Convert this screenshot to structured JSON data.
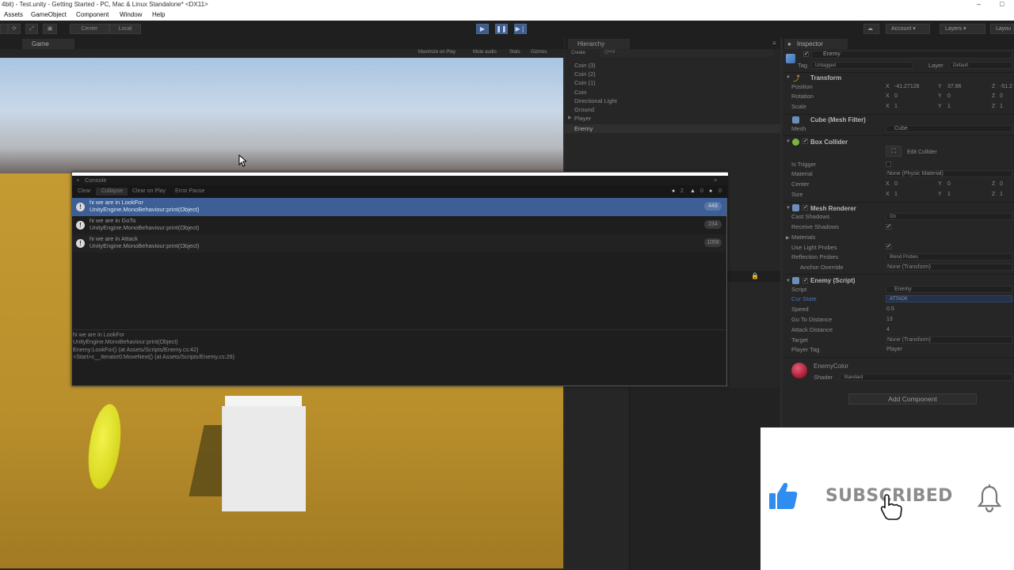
{
  "window": {
    "title": "4bit) - Test.unity - Getting Started - PC, Mac & Linux Standalone* <DX11>",
    "minimize": "–",
    "maximize": "□"
  },
  "menu": [
    "Assets",
    "GameObject",
    "Component",
    "Window",
    "Help"
  ],
  "toolbar": {
    "pivot": "Center",
    "space": "Local",
    "account": "Account",
    "layers": "Layers",
    "layout": "Layou"
  },
  "game": {
    "tab_label": "Game",
    "options": [
      "Maximize on Play",
      "Mute audio",
      "Stats",
      "Gizmos"
    ]
  },
  "hierarchy": {
    "tab_label": "Hierarchy",
    "create": "Create",
    "search_placeholder": "Q•All",
    "items": [
      "Coin (3)",
      "Coin (2)",
      "Coin (1)",
      "Coin",
      "Directional Light",
      "Ground",
      "Player",
      "Enemy"
    ]
  },
  "inspector": {
    "tab_label": "Inspector",
    "object_name": "Enemy",
    "tag_label": "Tag",
    "tag_value": "Untagged",
    "layer_label": "Layer",
    "layer_value": "Default",
    "transform": {
      "title": "Transform",
      "position_label": "Position",
      "rotation_label": "Rotation",
      "scale_label": "Scale",
      "position": [
        "-41.27128",
        "37.86",
        "-51.2"
      ],
      "rotation": [
        "0",
        "0",
        "0"
      ],
      "scale": [
        "1",
        "1",
        "1"
      ]
    },
    "mesh_filter": {
      "title": "Cube (Mesh Filter)",
      "mesh_label": "Mesh",
      "mesh_value": "Cube"
    },
    "box_collider": {
      "title": "Box Collider",
      "edit_button": "Edit Collider",
      "is_trigger_label": "Is Trigger",
      "material_label": "Material",
      "material_value": "None (Physic Material)",
      "center_label": "Center",
      "center": [
        "0",
        "0",
        "0"
      ],
      "size_label": "Size",
      "size": [
        "1",
        "1",
        "1"
      ]
    },
    "mesh_renderer": {
      "title": "Mesh Renderer",
      "cast_shadows_label": "Cast Shadows",
      "cast_shadows_value": "On",
      "receive_shadows_label": "Receive Shadows",
      "materials_label": "Materials",
      "light_probes_label": "Use Light Probes",
      "reflection_probes_label": "Reflection Probes",
      "reflection_probes_value": "Blend Probes",
      "anchor_label": "Anchor Override",
      "anchor_value": "None (Transform)"
    },
    "enemy_script": {
      "title": "Enemy (Script)",
      "script_label": "Script",
      "script_value": "Enemy",
      "cur_state_label": "Cur State",
      "cur_state_value": "ATTACK",
      "speed_label": "Speed",
      "speed_value": "0.5",
      "goto_label": "Go To Distance",
      "goto_value": "13",
      "attack_label": "Attack Distance",
      "attack_value": "4",
      "target_label": "Target",
      "target_value": "None (Transform)",
      "player_tag_label": "Player Tag",
      "player_tag_value": "Player"
    },
    "material": {
      "name": "EnemyColor",
      "shader_label": "Shader",
      "shader_value": "Standard"
    },
    "add_component": "Add Component"
  },
  "console": {
    "title": "Console",
    "buttons": [
      "Clear",
      "Collapse",
      "Clear on Play",
      "Error Pause"
    ],
    "counts": {
      "info": "2",
      "warn": "0",
      "error": "0"
    },
    "entries": [
      {
        "line1": "hi we are in LookFor",
        "line2": "UnityEngine.MonoBehaviour:print(Object)",
        "count": "448"
      },
      {
        "line1": "hi we are in GoTo",
        "line2": "UnityEngine.MonoBehaviour:print(Object)",
        "count": "234"
      },
      {
        "line1": "hi we are in Attack",
        "line2": "UnityEngine.MonoBehaviour:print(Object)",
        "count": "1058"
      }
    ],
    "detail": [
      "hi we are in LookFor",
      "UnityEngine.MonoBehaviour:print(Object)",
      "Enemy:LookFor() (at Assets/Scripts/Enemy.cs:42)",
      "<Start>c__Iterator0:MoveNext() (at Assets/Scripts/Enemy.cs:26)"
    ]
  },
  "overlay": {
    "subscribed": "SUBSCRIBED"
  },
  "colors": {
    "selection": "#3d5f96",
    "accent_blue": "#3f5d8a",
    "thumb_blue": "#2f8cf0"
  }
}
